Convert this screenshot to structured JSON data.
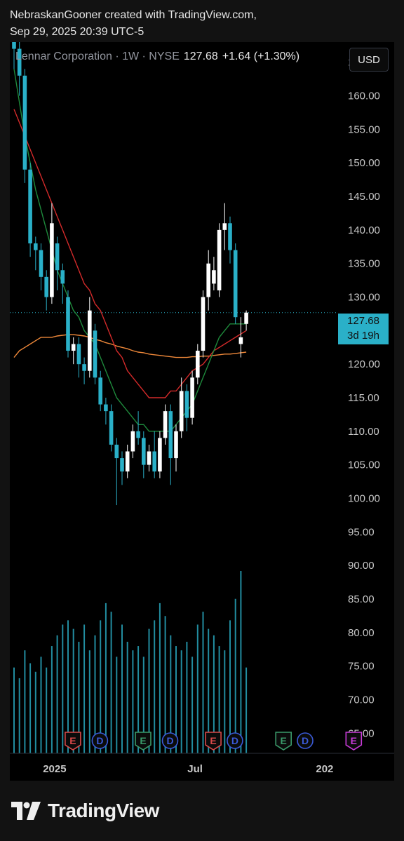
{
  "credit": {
    "line1": "NebraskanGooner created with TradingView.com,",
    "line2": "Sep 29, 2025 20:39 UTC-5"
  },
  "legend": {
    "symbol": "Lennar Corporation · 1W · NYSE",
    "price": "127.68",
    "change": "+1.64 (+1.30%)"
  },
  "currency_button": "USD",
  "price_tag": {
    "value": "127.68",
    "countdown": "3d 19h"
  },
  "logo_text": "TradingView",
  "colors": {
    "up": "#ffffff",
    "down": "#2ab0c8",
    "ma_green": "#1e8a3c",
    "ma_red": "#d42a2a",
    "ma_orange": "#f0893a",
    "volume": "#2ab0c8",
    "grid_text": "#c8c8c8"
  },
  "chart_data": {
    "type": "candlestick",
    "title": "",
    "interval": "1W",
    "ylim": [
      62,
      168
    ],
    "y_ticks": [
      "165.00",
      "160.00",
      "155.00",
      "150.00",
      "145.00",
      "140.00",
      "135.00",
      "130.00",
      "125.00",
      "120.00",
      "115.00",
      "110.00",
      "105.00",
      "100.00",
      "95.00",
      "90.00",
      "85.00",
      "80.00",
      "75.00",
      "70.00",
      "65.00"
    ],
    "x_ticks": [
      {
        "label": "2025",
        "index": 7
      },
      {
        "label": "Jul",
        "index": 33
      },
      {
        "label": "202",
        "index": 57
      }
    ],
    "candles": [
      {
        "o": 168,
        "h": 169,
        "l": 164,
        "c": 167
      },
      {
        "o": 167,
        "h": 168,
        "l": 160,
        "c": 163
      },
      {
        "o": 163,
        "h": 164,
        "l": 147,
        "c": 149
      },
      {
        "o": 149,
        "h": 150,
        "l": 136,
        "c": 138
      },
      {
        "o": 138,
        "h": 139,
        "l": 134,
        "c": 137
      },
      {
        "o": 137,
        "h": 138,
        "l": 131,
        "c": 133
      },
      {
        "o": 133,
        "h": 134,
        "l": 128,
        "c": 130
      },
      {
        "o": 130,
        "h": 144,
        "l": 129,
        "c": 141
      },
      {
        "o": 138,
        "h": 139,
        "l": 131,
        "c": 134
      },
      {
        "o": 134,
        "h": 135,
        "l": 129,
        "c": 132
      },
      {
        "o": 130,
        "h": 131,
        "l": 121,
        "c": 122
      },
      {
        "o": 122,
        "h": 124,
        "l": 120,
        "c": 123
      },
      {
        "o": 123,
        "h": 124,
        "l": 118,
        "c": 120
      },
      {
        "o": 120,
        "h": 121,
        "l": 117,
        "c": 119
      },
      {
        "o": 119,
        "h": 130,
        "l": 118,
        "c": 128
      },
      {
        "o": 125,
        "h": 126,
        "l": 117,
        "c": 118
      },
      {
        "o": 118,
        "h": 119,
        "l": 113,
        "c": 114
      },
      {
        "o": 114,
        "h": 115,
        "l": 111,
        "c": 113
      },
      {
        "o": 113,
        "h": 114,
        "l": 107,
        "c": 108
      },
      {
        "o": 108,
        "h": 109,
        "l": 99,
        "c": 106
      },
      {
        "o": 106,
        "h": 107,
        "l": 102,
        "c": 104
      },
      {
        "o": 104,
        "h": 108,
        "l": 103,
        "c": 107
      },
      {
        "o": 107,
        "h": 111,
        "l": 106,
        "c": 110
      },
      {
        "o": 110,
        "h": 113,
        "l": 108,
        "c": 109
      },
      {
        "o": 109,
        "h": 110,
        "l": 103,
        "c": 105
      },
      {
        "o": 105,
        "h": 108,
        "l": 104,
        "c": 107
      },
      {
        "o": 107,
        "h": 110,
        "l": 103,
        "c": 104
      },
      {
        "o": 104,
        "h": 110,
        "l": 103,
        "c": 109
      },
      {
        "o": 109,
        "h": 114,
        "l": 108,
        "c": 113
      },
      {
        "o": 113,
        "h": 114,
        "l": 102,
        "c": 106
      },
      {
        "o": 106,
        "h": 111,
        "l": 104,
        "c": 110
      },
      {
        "o": 110,
        "h": 118,
        "l": 109,
        "c": 116
      },
      {
        "o": 116,
        "h": 117,
        "l": 110,
        "c": 112
      },
      {
        "o": 112,
        "h": 119,
        "l": 111,
        "c": 118
      },
      {
        "o": 118,
        "h": 123,
        "l": 117,
        "c": 122
      },
      {
        "o": 122,
        "h": 131,
        "l": 121,
        "c": 130
      },
      {
        "o": 130,
        "h": 137,
        "l": 128,
        "c": 135
      },
      {
        "o": 132,
        "h": 136,
        "l": 131,
        "c": 134
      },
      {
        "o": 131,
        "h": 141,
        "l": 130,
        "c": 140
      },
      {
        "o": 140,
        "h": 144,
        "l": 137,
        "c": 141
      },
      {
        "o": 141,
        "h": 142,
        "l": 135,
        "c": 137
      },
      {
        "o": 137,
        "h": 138,
        "l": 126,
        "c": 127
      },
      {
        "o": 123,
        "h": 127,
        "l": 121,
        "c": 124
      },
      {
        "o": 126,
        "h": 128,
        "l": 125,
        "c": 127.68
      }
    ],
    "ma_green": [
      164,
      159,
      154,
      150,
      146,
      143,
      140,
      137,
      134,
      132,
      130,
      128,
      127,
      125,
      124,
      123,
      121,
      119,
      117,
      115,
      114,
      113,
      112,
      111,
      111,
      110,
      110,
      110,
      110,
      110,
      111,
      112,
      113,
      114,
      116,
      118,
      120,
      122,
      124,
      125,
      126,
      126,
      126,
      126
    ],
    "ma_red": [
      158,
      156,
      154,
      152,
      150,
      148,
      146,
      144,
      142,
      140,
      138,
      136,
      134,
      132,
      131,
      129,
      128,
      126,
      124,
      122,
      121,
      119,
      118,
      117,
      116,
      115,
      115,
      115,
      115,
      116,
      116,
      117,
      118,
      119,
      119.5,
      120,
      121,
      122,
      122.5,
      123,
      123.5,
      124,
      124.5,
      125
    ],
    "ma_orange": [
      121,
      122,
      122.5,
      123,
      123.5,
      124,
      124,
      124,
      124.2,
      124.3,
      124.4,
      124.4,
      124.3,
      124.2,
      124,
      123.7,
      123.5,
      123.2,
      123,
      122.7,
      122.5,
      122.3,
      122,
      121.8,
      121.7,
      121.5,
      121.4,
      121.3,
      121.2,
      121.1,
      121,
      121,
      121,
      121.1,
      121.1,
      121.2,
      121.2,
      121.3,
      121.4,
      121.5,
      121.5,
      121.6,
      121.7,
      121.8
    ],
    "volume": [
      40,
      35,
      48,
      42,
      38,
      45,
      40,
      50,
      55,
      60,
      62,
      58,
      52,
      60,
      48,
      55,
      62,
      70,
      66,
      45,
      60,
      52,
      48,
      50,
      45,
      58,
      62,
      70,
      64,
      55,
      50,
      48,
      52,
      45,
      60,
      66,
      58,
      55,
      50,
      48,
      62,
      72,
      85,
      40
    ],
    "events": [
      {
        "label": "E",
        "kind": "earnings-down",
        "index": 7
      },
      {
        "label": "D",
        "kind": "dividend",
        "index": 12
      },
      {
        "label": "E",
        "kind": "earnings-up",
        "index": 20
      },
      {
        "label": "D",
        "kind": "dividend",
        "index": 25
      },
      {
        "label": "E",
        "kind": "earnings-down",
        "index": 33
      },
      {
        "label": "D",
        "kind": "dividend",
        "index": 37
      },
      {
        "label": "E",
        "kind": "earnings-up",
        "index": 46
      },
      {
        "label": "D",
        "kind": "dividend",
        "index": 50
      },
      {
        "label": "E",
        "kind": "split",
        "index": 59
      }
    ]
  }
}
